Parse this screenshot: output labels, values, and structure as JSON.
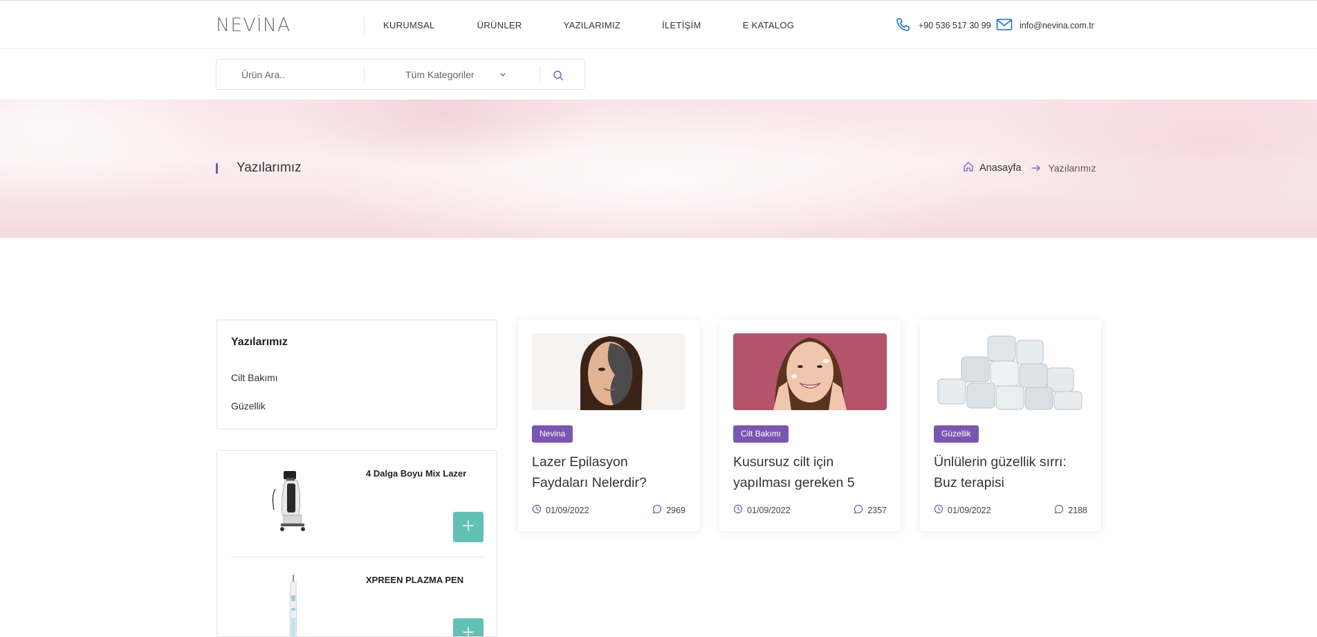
{
  "header": {
    "logo_text": "NEVİNA",
    "nav": [
      "KURUMSAL",
      "ÜRÜNLER",
      "YAZILARIMIZ",
      "İLETİŞİM",
      "E KATALOG"
    ],
    "phone": "+90 536 517 30 99",
    "email": "info@nevina.com.tr"
  },
  "search": {
    "placeholder": "Ürün Ara..",
    "category": "Tüm Kategoriler"
  },
  "hero": {
    "title": "Yazılarımız",
    "breadcrumb": {
      "home": "Anasayfa",
      "current": "Yazılarımız"
    }
  },
  "sidebar": {
    "categories_title": "Yazılarımız",
    "categories": [
      "Cilt Bakımı",
      "Güzellik"
    ],
    "products": [
      {
        "name": "4 Dalga Boyu Mix Lazer",
        "add_label": "+"
      },
      {
        "name": "XPREEN PLAZMA PEN",
        "add_label": "+"
      }
    ]
  },
  "posts": [
    {
      "badge": "Nevina",
      "title": "Lazer Epilasyon Faydaları Nelerdir?",
      "date": "01/09/2022",
      "views": "2969"
    },
    {
      "badge": "Cilt Bakımı",
      "title": "Kusursuz cilt için yapılması gereken 5",
      "date": "01/09/2022",
      "views": "2357"
    },
    {
      "badge": "Güzellik",
      "title": "Ünlülerin güzellik sırrı: Buz terapisi",
      "date": "01/09/2022",
      "views": "2188"
    }
  ],
  "colors": {
    "accent": "#7b56b0",
    "teal": "#62c1b4",
    "icon_blue": "#1f6fd1"
  },
  "icons": {
    "phone": "phone-icon",
    "email": "mail-icon",
    "search": "search-icon",
    "chevron": "chevron-down-icon",
    "home": "home-icon",
    "arrow": "arrow-right-icon",
    "date": "clock-icon",
    "views": "comment-icon",
    "add": "plus-icon"
  }
}
